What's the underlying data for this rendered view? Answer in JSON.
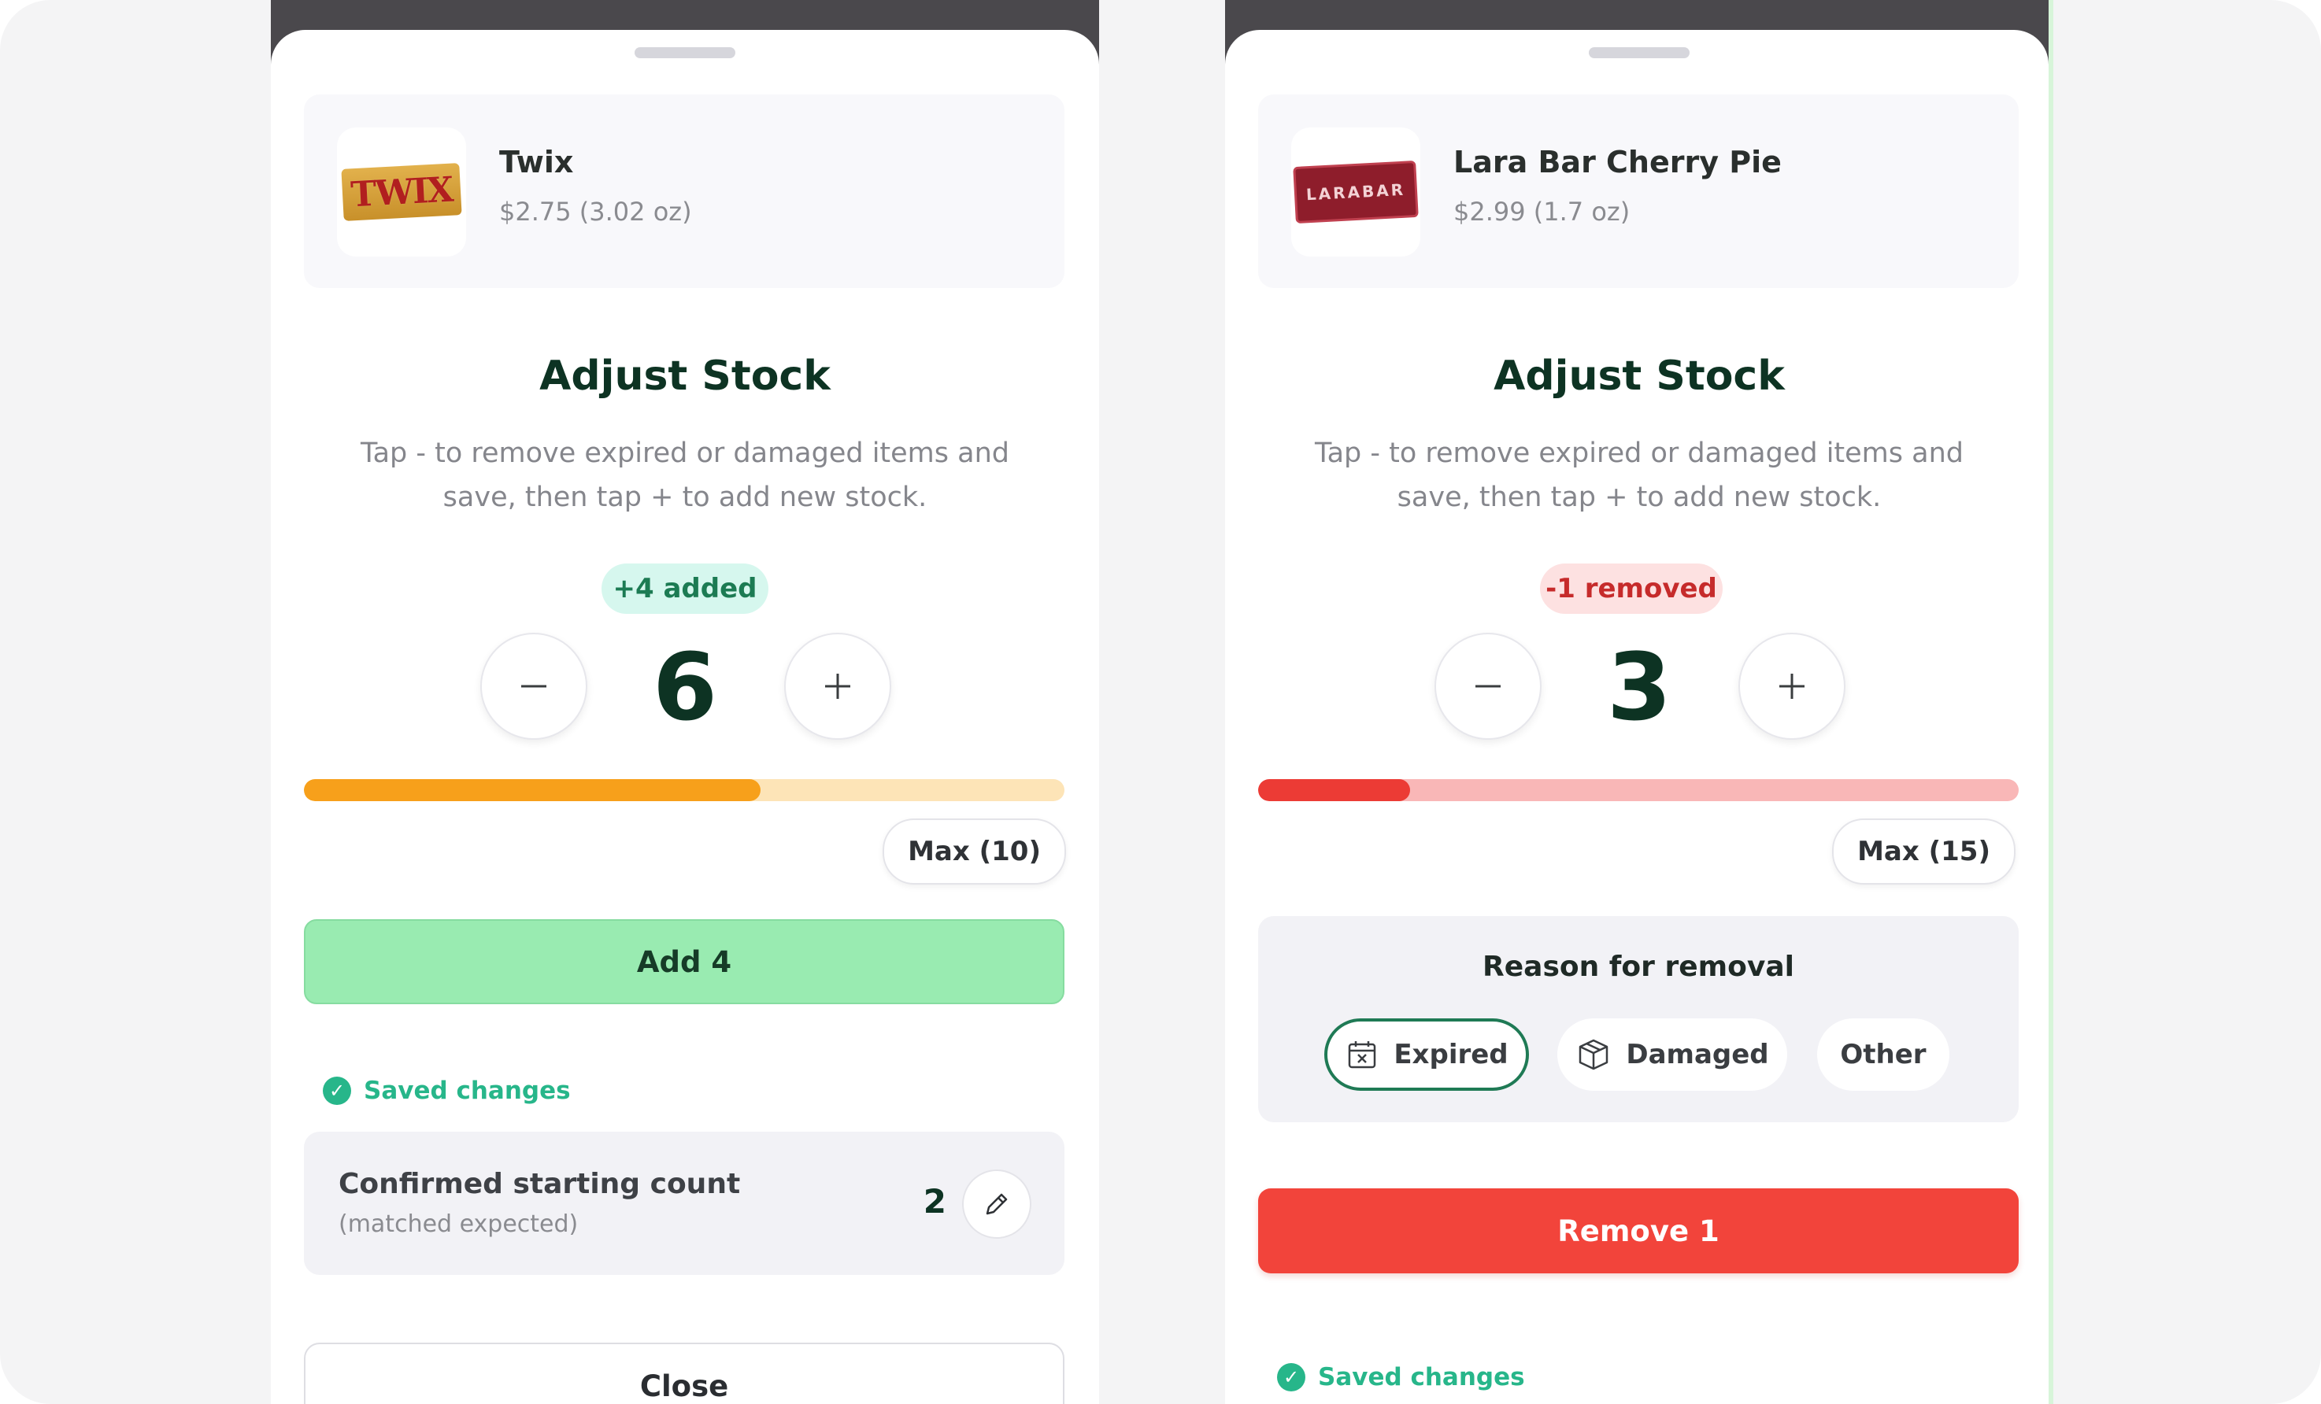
{
  "screens": [
    {
      "product": {
        "name": "Twix",
        "price": "$2.75 (3.02 oz)",
        "image_text": "TWIX"
      },
      "title": "Adjust Stock",
      "description": "Tap - to remove expired or damaged items and save, then tap + to add new stock.",
      "change_badge": "+4 added",
      "count": "6",
      "stock_level": 0.6,
      "max_label": "Max (10)",
      "action_label": "Add 4",
      "saved_label": "Saved changes",
      "confirmed": {
        "label": "Confirmed starting count",
        "sub": "(matched expected)",
        "value": "2"
      },
      "close_label": "Close",
      "colors": {
        "fill": "#f7a01b",
        "track": "#fde4b7",
        "action": "#99ebb1"
      }
    },
    {
      "product": {
        "name": "Lara Bar Cherry Pie",
        "price": "$2.99 (1.7 oz)",
        "image_text": "LARABAR"
      },
      "title": "Adjust Stock",
      "description": "Tap - to remove expired or damaged items and save, then tap + to add new stock.",
      "change_badge": "-1 removed",
      "count": "3",
      "stock_level": 0.2,
      "max_label": "Max (15)",
      "reason": {
        "title": "Reason for removal",
        "options": [
          "Expired",
          "Damaged",
          "Other"
        ],
        "selected": "Expired"
      },
      "action_label": "Remove 1",
      "saved_label": "Saved changes",
      "colors": {
        "fill": "#ec3b35",
        "track": "#f9b7b7",
        "action": "#f2443b"
      }
    }
  ],
  "stepper_icons": {
    "minus": "minus-icon",
    "plus": "plus-icon"
  }
}
